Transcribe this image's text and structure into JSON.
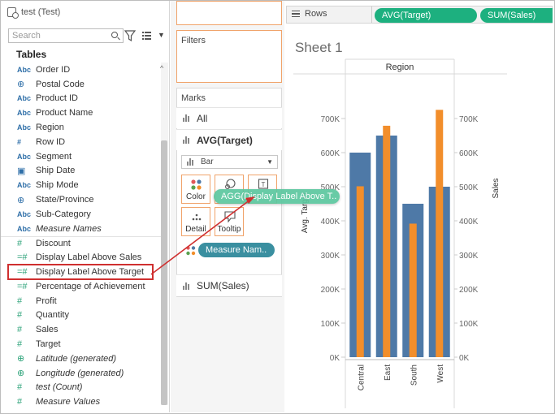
{
  "datasource": {
    "name": "test (Test)"
  },
  "search": {
    "placeholder": "Search"
  },
  "tables_title": "Tables",
  "fields": [
    {
      "icon": "Abc",
      "label": "Order ID",
      "kind": "dim"
    },
    {
      "icon": "globe",
      "label": "Postal Code",
      "kind": "geo"
    },
    {
      "icon": "Abc",
      "label": "Product ID",
      "kind": "dim"
    },
    {
      "icon": "Abc",
      "label": "Product Name",
      "kind": "dim"
    },
    {
      "icon": "Abc",
      "label": "Region",
      "kind": "dim"
    },
    {
      "icon": "#",
      "label": "Row ID",
      "kind": "dimnum"
    },
    {
      "icon": "Abc",
      "label": "Segment",
      "kind": "dim"
    },
    {
      "icon": "calendar",
      "label": "Ship Date",
      "kind": "date"
    },
    {
      "icon": "Abc",
      "label": "Ship Mode",
      "kind": "dim"
    },
    {
      "icon": "globe",
      "label": "State/Province",
      "kind": "geo"
    },
    {
      "icon": "Abc",
      "label": "Sub-Category",
      "kind": "dim"
    },
    {
      "icon": "Abc",
      "label": "Measure Names",
      "kind": "dim",
      "italic": true
    },
    {
      "icon": "#",
      "label": "Discount",
      "kind": "measure",
      "sep": true
    },
    {
      "icon": "=#",
      "label": "Display Label Above Sales",
      "kind": "measure"
    },
    {
      "icon": "=#",
      "label": "Display Label Above Target",
      "kind": "measure",
      "highlight": true
    },
    {
      "icon": "=#",
      "label": "Percentage of Achievement",
      "kind": "measure"
    },
    {
      "icon": "#",
      "label": "Profit",
      "kind": "measure"
    },
    {
      "icon": "#",
      "label": "Quantity",
      "kind": "measure"
    },
    {
      "icon": "#",
      "label": "Sales",
      "kind": "measure"
    },
    {
      "icon": "#",
      "label": "Target",
      "kind": "measure"
    },
    {
      "icon": "globe",
      "label": "Latitude (generated)",
      "kind": "measure",
      "italic": true
    },
    {
      "icon": "globe",
      "label": "Longitude (generated)",
      "kind": "measure",
      "italic": true
    },
    {
      "icon": "#",
      "label": "test (Count)",
      "kind": "measure",
      "italic": true
    },
    {
      "icon": "#",
      "label": "Measure Values",
      "kind": "measure",
      "italic": true
    }
  ],
  "filters_title": "Filters",
  "marks": {
    "title": "Marks",
    "all_label": "All",
    "avg_target_label": "AVG(Target)",
    "sum_sales_label": "SUM(Sales)",
    "mark_type": "Bar",
    "buttons": {
      "color": "Color",
      "size": "Size",
      "label": "Label",
      "detail": "Detail",
      "tooltip": "Tooltip"
    },
    "measure_names_pill": "Measure Nam..",
    "dragging_pill": "AGG(Display Label Above T.."
  },
  "rows_shelf": {
    "label": "Rows",
    "pills": [
      "AVG(Target)",
      "SUM(Sales)"
    ]
  },
  "sheet_title": "Sheet 1",
  "colors": {
    "target_bar": "#4e79a7",
    "sales_bar": "#f28e2b",
    "pill_green": "#1db07f",
    "pill_blue": "#3a8fa0",
    "highlight_red": "#cf2f2f"
  },
  "chart_data": {
    "type": "bar",
    "header": "Region",
    "categories": [
      "Central",
      "East",
      "South",
      "West"
    ],
    "series": [
      {
        "name": "Avg. Target",
        "values": [
          600000,
          650000,
          450000,
          500000
        ]
      },
      {
        "name": "Sales",
        "values": [
          501240,
          678781,
          391722,
          725458
        ]
      }
    ],
    "ylabel_left": "Avg. Target",
    "ylabel_right": "Sales",
    "ylim": [
      0,
      800000
    ],
    "yticks": [
      "0K",
      "100K",
      "200K",
      "300K",
      "400K",
      "500K",
      "600K",
      "700K"
    ]
  }
}
